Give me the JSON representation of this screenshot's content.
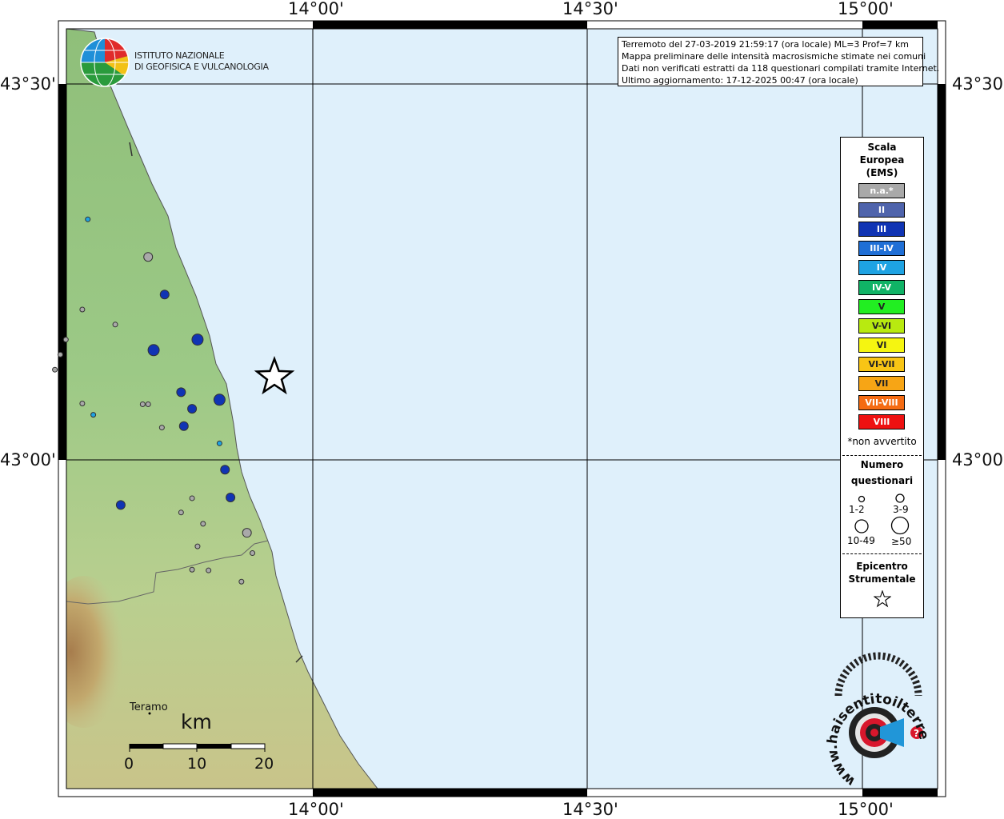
{
  "axes": {
    "top": [
      "14°00'",
      "14°30'",
      "15°00'"
    ],
    "bottom": [
      "14°00'",
      "14°30'",
      "15°00'"
    ],
    "left": [
      "43°30'",
      "43°00'"
    ],
    "right": [
      "43°30'",
      "43°00'"
    ]
  },
  "logo": {
    "line1": "ISTITUTO NAZIONALE",
    "line2": "DI GEOFISICA E VULCANOLOGIA"
  },
  "info": {
    "line1": "Terremoto del 27-03-2019 21:59:17 (ora locale) ML=3 Prof=7 km",
    "line2": "Mappa preliminare delle intensità macrosismiche stimate nei comuni",
    "line3": "Dati non verificati estratti da 118 questionari compilati tramite Internet.",
    "line4": "Ultimo aggiornamento: 17-12-2025 00:47 (ora locale)"
  },
  "legend": {
    "title1": "Scala",
    "title2": "Europea",
    "title3": "(EMS)",
    "classes": [
      {
        "label": "n.a.*",
        "color": "#a9a9a9"
      },
      {
        "label": "II",
        "color": "#4f64ac"
      },
      {
        "label": "III",
        "color": "#1034b4"
      },
      {
        "label": "III-IV",
        "color": "#1f6fd6"
      },
      {
        "label": "IV",
        "color": "#1ea3e3"
      },
      {
        "label": "IV-V",
        "color": "#10b366"
      },
      {
        "label": "V",
        "color": "#22ee22"
      },
      {
        "label": "V-VI",
        "color": "#b8ea10"
      },
      {
        "label": "VI",
        "color": "#f5f511"
      },
      {
        "label": "VI-VII",
        "color": "#f8c515"
      },
      {
        "label": "VII",
        "color": "#f7a515"
      },
      {
        "label": "VII-VIII",
        "color": "#f56b12"
      },
      {
        "label": "VIII",
        "color": "#ee1111"
      }
    ],
    "note": "*non avvertito",
    "count_title1": "Numero",
    "count_title2": "questionari",
    "sizes": [
      "1-2",
      "3-9",
      "10-49",
      "≥50"
    ],
    "epi_title1": "Epicentro",
    "epi_title2": "Strumentale"
  },
  "map": {
    "place": "Teramo",
    "scale_unit": "km",
    "scale_ticks": [
      "0",
      "10",
      "20"
    ],
    "points": [
      {
        "lon": 13.59,
        "lat": 43.32,
        "ems": "IV",
        "n": "1-2"
      },
      {
        "lon": 13.7,
        "lat": 43.27,
        "ems": "n.a.*",
        "n": "3-9"
      },
      {
        "lon": 13.73,
        "lat": 43.22,
        "ems": "III",
        "n": "3-9"
      },
      {
        "lon": 13.58,
        "lat": 43.2,
        "ems": "n.a.*",
        "n": "1-2"
      },
      {
        "lon": 13.64,
        "lat": 43.18,
        "ems": "n.a.*",
        "n": "1-2"
      },
      {
        "lon": 13.55,
        "lat": 43.16,
        "ems": "n.a.*",
        "n": "1-2"
      },
      {
        "lon": 13.79,
        "lat": 43.16,
        "ems": "III",
        "n": "10-49"
      },
      {
        "lon": 13.71,
        "lat": 43.146,
        "ems": "III",
        "n": "10-49"
      },
      {
        "lon": 13.54,
        "lat": 43.14,
        "ems": "n.a.*",
        "n": "1-2"
      },
      {
        "lon": 13.53,
        "lat": 43.12,
        "ems": "n.a.*",
        "n": "1-2"
      },
      {
        "lon": 13.76,
        "lat": 43.09,
        "ems": "III",
        "n": "3-9"
      },
      {
        "lon": 13.83,
        "lat": 43.08,
        "ems": "III",
        "n": "10-49"
      },
      {
        "lon": 13.58,
        "lat": 43.075,
        "ems": "n.a.*",
        "n": "1-2"
      },
      {
        "lon": 13.69,
        "lat": 43.074,
        "ems": "n.a.*",
        "n": "1-2"
      },
      {
        "lon": 13.7,
        "lat": 43.074,
        "ems": "n.a.*",
        "n": "1-2"
      },
      {
        "lon": 13.78,
        "lat": 43.068,
        "ems": "III",
        "n": "3-9"
      },
      {
        "lon": 13.6,
        "lat": 43.06,
        "ems": "IV",
        "n": "1-2"
      },
      {
        "lon": 13.725,
        "lat": 43.043,
        "ems": "n.a.*",
        "n": "1-2"
      },
      {
        "lon": 13.765,
        "lat": 43.045,
        "ems": "III",
        "n": "3-9"
      },
      {
        "lon": 13.83,
        "lat": 43.022,
        "ems": "IV",
        "n": "1-2"
      },
      {
        "lon": 13.84,
        "lat": 42.987,
        "ems": "III",
        "n": "3-9"
      },
      {
        "lon": 13.65,
        "lat": 42.94,
        "ems": "III",
        "n": "3-9"
      },
      {
        "lon": 13.78,
        "lat": 42.949,
        "ems": "n.a.*",
        "n": "1-2"
      },
      {
        "lon": 13.85,
        "lat": 42.95,
        "ems": "III",
        "n": "3-9"
      },
      {
        "lon": 13.76,
        "lat": 42.93,
        "ems": "n.a.*",
        "n": "1-2"
      },
      {
        "lon": 13.8,
        "lat": 42.915,
        "ems": "n.a.*",
        "n": "1-2"
      },
      {
        "lon": 13.88,
        "lat": 42.903,
        "ems": "n.a.*",
        "n": "3-9"
      },
      {
        "lon": 13.79,
        "lat": 42.885,
        "ems": "n.a.*",
        "n": "1-2"
      },
      {
        "lon": 13.89,
        "lat": 42.876,
        "ems": "n.a.*",
        "n": "1-2"
      },
      {
        "lon": 13.78,
        "lat": 42.854,
        "ems": "n.a.*",
        "n": "1-2"
      },
      {
        "lon": 13.81,
        "lat": 42.853,
        "ems": "n.a.*",
        "n": "1-2"
      },
      {
        "lon": 13.87,
        "lat": 42.838,
        "ems": "n.a.*",
        "n": "1-2"
      }
    ],
    "epicenter": {
      "lon": 13.93,
      "lat": 43.11
    }
  },
  "badge": {
    "text": "www.haisentitoilterremoto.it",
    "mark": "?"
  },
  "colors": {
    "sea": "#dff0fb",
    "coast": "#555555"
  }
}
